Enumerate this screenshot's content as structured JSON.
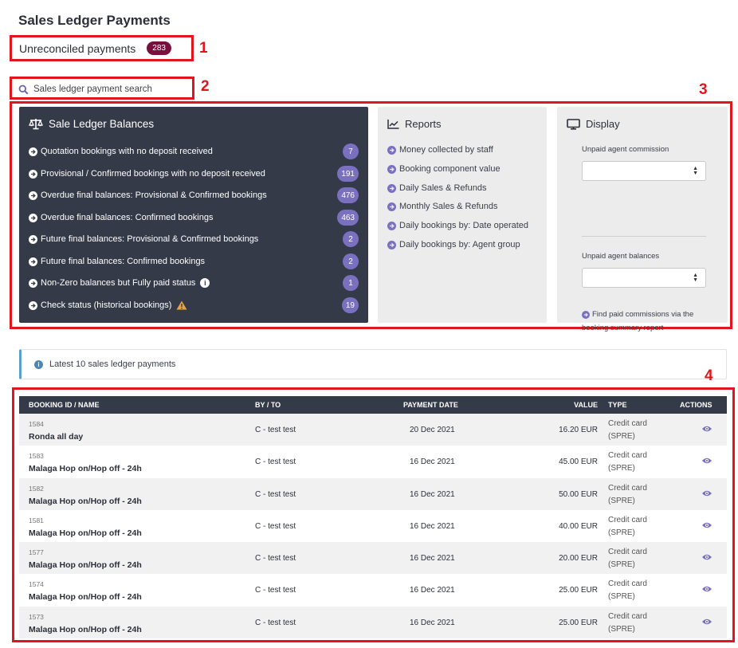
{
  "page": {
    "title": "Sales Ledger Payments"
  },
  "unreconciled": {
    "label": "Unreconciled payments",
    "count": "283"
  },
  "search": {
    "placeholder": "Sales ledger payment search"
  },
  "callouts": [
    "1",
    "2",
    "3",
    "4"
  ],
  "balances": {
    "title": "Sale Ledger Balances",
    "items": [
      {
        "label": "Quotation bookings with no deposit received",
        "count": "7"
      },
      {
        "label": "Provisional / Confirmed bookings with no deposit received",
        "count": "191"
      },
      {
        "label": "Overdue final balances: Provisional & Confirmed bookings",
        "count": "476"
      },
      {
        "label": "Overdue final balances: Confirmed bookings",
        "count": "463"
      },
      {
        "label": "Future final balances: Provisional & Confirmed bookings",
        "count": "2"
      },
      {
        "label": "Future final balances: Confirmed bookings",
        "count": "2"
      },
      {
        "label": "Non-Zero balances but Fully paid status",
        "count": "1"
      },
      {
        "label": "Check status (historical bookings)",
        "count": "19"
      }
    ]
  },
  "reports": {
    "title": "Reports",
    "items": [
      "Money collected by staff",
      "Booking component value",
      "Daily Sales & Refunds",
      "Monthly Sales & Refunds",
      "Daily bookings by: Date operated",
      "Daily bookings by: Agent group"
    ]
  },
  "display": {
    "title": "Display",
    "unpaid_commission_label": "Unpaid agent commission",
    "find_link": "Find paid commissions via the booking summary report",
    "unpaid_balances_label": "Unpaid agent balances"
  },
  "latest": {
    "text": "Latest 10 sales ledger payments"
  },
  "table": {
    "headers": {
      "booking": "BOOKING ID / NAME",
      "by": "BY / TO",
      "date": "PAYMENT DATE",
      "value": "VALUE",
      "type": "TYPE",
      "actions": "ACTIONS"
    },
    "rows": [
      {
        "id": "1584",
        "name": "Ronda all day",
        "by": "C - test test",
        "date": "20 Dec 2021",
        "value": "16.20 EUR",
        "type1": "Credit card",
        "type2": "(SPRE)"
      },
      {
        "id": "1583",
        "name": "Malaga Hop on/Hop off - 24h",
        "by": "C - test test",
        "date": "16 Dec 2021",
        "value": "45.00 EUR",
        "type1": "Credit card",
        "type2": "(SPRE)"
      },
      {
        "id": "1582",
        "name": "Malaga Hop on/Hop off - 24h",
        "by": "C - test test",
        "date": "16 Dec 2021",
        "value": "50.00 EUR",
        "type1": "Credit card",
        "type2": "(SPRE)"
      },
      {
        "id": "1581",
        "name": "Malaga Hop on/Hop off - 24h",
        "by": "C - test test",
        "date": "16 Dec 2021",
        "value": "40.00 EUR",
        "type1": "Credit card",
        "type2": "(SPRE)"
      },
      {
        "id": "1577",
        "name": "Malaga Hop on/Hop off - 24h",
        "by": "C - test test",
        "date": "16 Dec 2021",
        "value": "20.00 EUR",
        "type1": "Credit card",
        "type2": "(SPRE)"
      },
      {
        "id": "1574",
        "name": "Malaga Hop on/Hop off - 24h",
        "by": "C - test test",
        "date": "16 Dec 2021",
        "value": "25.00 EUR",
        "type1": "Credit card",
        "type2": "(SPRE)"
      },
      {
        "id": "1573",
        "name": "Malaga Hop on/Hop off - 24h",
        "by": "C - test test",
        "date": "16 Dec 2021",
        "value": "25.00 EUR",
        "type1": "Credit card",
        "type2": "(SPRE)"
      }
    ]
  },
  "colors": {
    "callout_red": "#e0161f",
    "dark_panel": "#343a48",
    "accent_purple": "#7a70c0",
    "unreconciled_badge": "#7a0f3e"
  }
}
